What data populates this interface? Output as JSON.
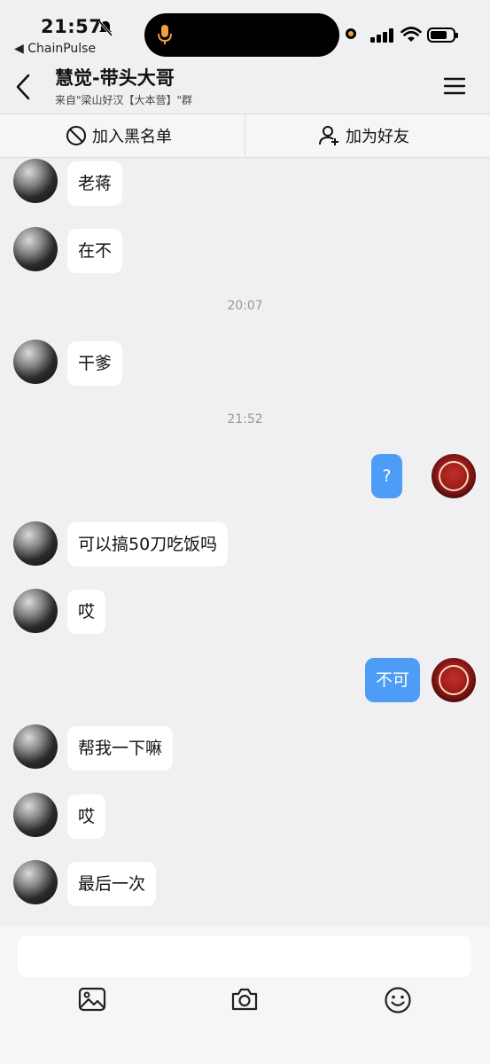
{
  "status_bar": {
    "time": "21:57",
    "back_app": "◀ ChainPulse"
  },
  "header": {
    "title": "慧觉-带头大哥",
    "subtitle": "来自\"梁山好汉【大本营】\"群"
  },
  "actions": {
    "blacklist": "加入黑名单",
    "add_friend": "加为好友"
  },
  "messages": [
    {
      "from": "other",
      "text": "老蒋"
    },
    {
      "from": "other",
      "text": "在不"
    },
    {
      "type": "timestamp",
      "text": "20:07"
    },
    {
      "from": "other",
      "text": "干爹"
    },
    {
      "type": "timestamp",
      "text": "21:52"
    },
    {
      "from": "me",
      "text": "?"
    },
    {
      "from": "other",
      "text": "可以搞50刀吃饭吗"
    },
    {
      "from": "other",
      "text": "哎"
    },
    {
      "from": "me",
      "text": "不可"
    },
    {
      "from": "other",
      "text": "帮我一下嘛"
    },
    {
      "from": "other",
      "text": "哎"
    },
    {
      "from": "other",
      "text": "最后一次"
    }
  ],
  "input": {
    "placeholder": ""
  },
  "colors": {
    "my_bubble": "#4d9cf6",
    "background": "#f0f0f2"
  },
  "icons": [
    "microphone-icon",
    "back-chevron-icon",
    "menu-icon",
    "block-icon",
    "add-friend-icon",
    "image-icon",
    "camera-icon",
    "emoji-icon"
  ]
}
